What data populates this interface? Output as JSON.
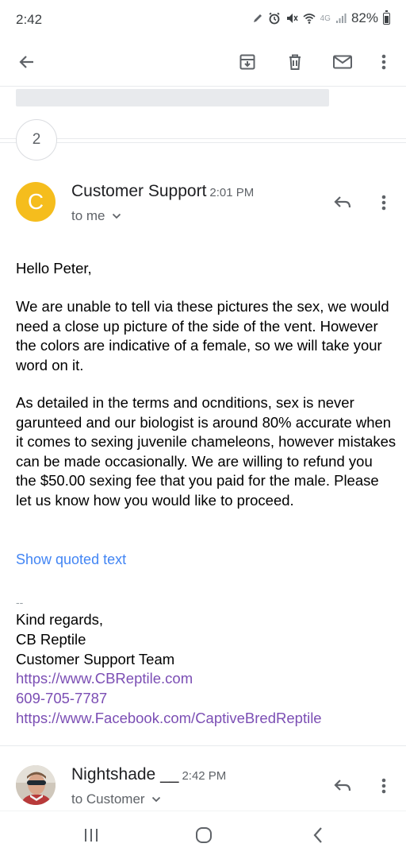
{
  "status_bar": {
    "time": "2:42",
    "network": "4G",
    "battery": "82%"
  },
  "toolbar": {
    "back_icon": "arrow-back-icon",
    "archive_icon": "archive-icon",
    "delete_icon": "trash-icon",
    "mark_unread_icon": "mail-icon",
    "more_icon": "more-vert-icon"
  },
  "collapsed": {
    "count": "2"
  },
  "message1": {
    "avatar_letter": "C",
    "avatar_color": "#f5bd1d",
    "sender": "Customer Support",
    "time": "2:01 PM",
    "recipient": "to me",
    "greeting": "Hello Peter,",
    "paragraph1": "We are unable to tell via these pictures the sex, we would need a close up picture of the side of the vent. However the colors are indicative of a female, so we will take your word on it.",
    "paragraph2": "As detailed in the terms and ocnditions, sex is never garunteed and our biologist is around 80% accurate when it comes to sexing juvenile chameleons, however mistakes can be made occasionally. We are willing to refund you the $50.00 sexing fee that you paid for the male. Please let us know how you would like to proceed.",
    "show_quoted": "Show quoted text",
    "signature": {
      "dash": "--",
      "regards": "Kind regards,",
      "company": "CB Reptile",
      "team": "Customer Support Team",
      "website": "https://www.CBReptile.com",
      "phone": "609-705-7787",
      "facebook": "https://www.Facebook.com/CaptiveBredReptile"
    }
  },
  "message2": {
    "sender": "Nightshade __",
    "time": "2:42 PM",
    "recipient": "to Customer"
  },
  "colors": {
    "link_blue": "#4285f4",
    "link_purple": "#7b4eb4",
    "icon_gray": "#5f6368"
  }
}
